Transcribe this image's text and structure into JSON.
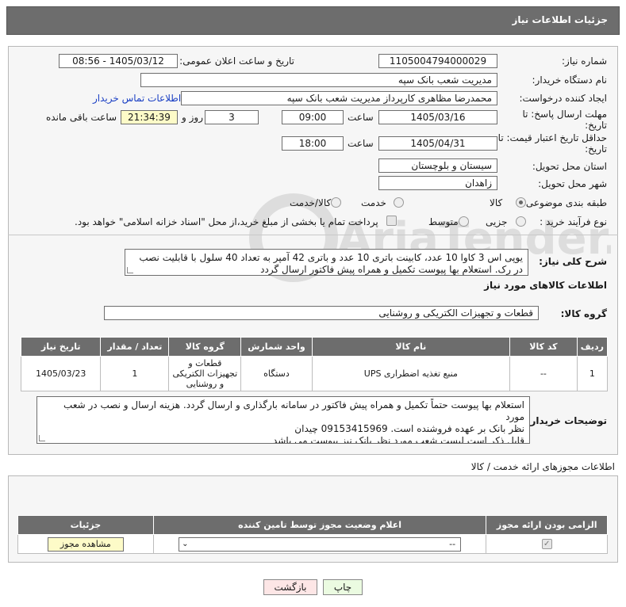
{
  "header": {
    "title": "جزئیات اطلاعات نیاز"
  },
  "form": {
    "need_number_label": "شماره نیاز:",
    "need_number": "1105004794000029",
    "announce_label": "تاریخ و ساعت اعلان عمومی:",
    "announce_value": "1405/03/12 - 08:56",
    "buyer_org_label": "نام دستگاه خریدار:",
    "buyer_org": "مدیریت شعب بانک سپه",
    "creator_label": "ایجاد کننده درخواست:",
    "creator": "محمدرضا مظاهری کارپرداز مدیریت شعب بانک سپه",
    "contact_link": "اطلاعات تماس خریدار",
    "deadline_label": "مهلت ارسال پاسخ: تا تاریخ:",
    "deadline_date": "1405/03/16",
    "time_label": "ساعت",
    "deadline_time": "09:00",
    "days_value": "3",
    "days_label": "روز و",
    "remaining_time": "21:34:39",
    "remaining_label": "ساعت باقی مانده",
    "validity_label": "حداقل تاریخ اعتبار قیمت: تا تاریخ:",
    "validity_date": "1405/04/31",
    "validity_time": "18:00",
    "province_label": "استان محل تحویل:",
    "province": "سیستان و بلوچستان",
    "city_label": "شهر محل تحویل:",
    "city": "زاهدان",
    "category_label": "طبقه بندی موضوعی:",
    "category_options": [
      "کالا",
      "خدمت",
      "کالا/خدمت"
    ],
    "category_selected": "کالا",
    "process_label": "نوع فرآیند خرید :",
    "process_options": [
      "جزیی",
      "متوسط"
    ],
    "payment_note": "پرداخت تمام یا بخشی از مبلغ خرید،از محل \"اسناد خزانه اسلامی\" خواهد بود."
  },
  "summary": {
    "label": "شرح کلی نیاز:",
    "text": "یوپی اس 3 کاوا 10 عدد، کابینت باتری 10 عدد و باتری 42 آمپر به تعداد 40 سلول با قابلیت نصب در رک. استعلام بها پیوست تکمیل و همراه پیش فاکتور ارسال گردد"
  },
  "goods": {
    "section_title": "اطلاعات کالاهای مورد نیاز",
    "group_label": "گروه کالا:",
    "group_value": "قطعات و تجهیزات الکتریکی و روشنایی",
    "columns": [
      "ردیف",
      "کد کالا",
      "نام کالا",
      "واحد شمارش",
      "گروه کالا",
      "تعداد / مقدار",
      "تاریخ نیاز"
    ],
    "rows": [
      [
        "1",
        "--",
        "منبع تغذیه اضطراری UPS",
        "دستگاه",
        "قطعات و تجهیزات الکتریکی و روشنایی",
        "1",
        "1405/03/23"
      ]
    ]
  },
  "buyer_notes": {
    "label": "توضیحات خریدار:",
    "lines": [
      "استعلام بها پیوست حتماً تکمیل و همراه پیش فاکتور در سامانه بارگذاری و ارسال گردد. هزینه ارسال و نصب در شعب مورد",
      "نظر بانک بر عهده فروشنده است. 09153415969 چیدان",
      "قابل ذکر است لیست شعب مورد نظر بانک نیز پیوست می باشد"
    ]
  },
  "permits": {
    "section_title": "اطلاعات مجوزهای ارائه خدمت / کالا",
    "columns": [
      "الزامی بودن ارائه مجوز",
      "اعلام وضعیت مجوز توسط تامین کننده",
      "جزئیات"
    ],
    "select_value": "--",
    "view_button": "مشاهده مجوز"
  },
  "actions": {
    "print": "چاپ",
    "back": "بازگشت"
  },
  "watermark_text": "AriaTender.net"
}
